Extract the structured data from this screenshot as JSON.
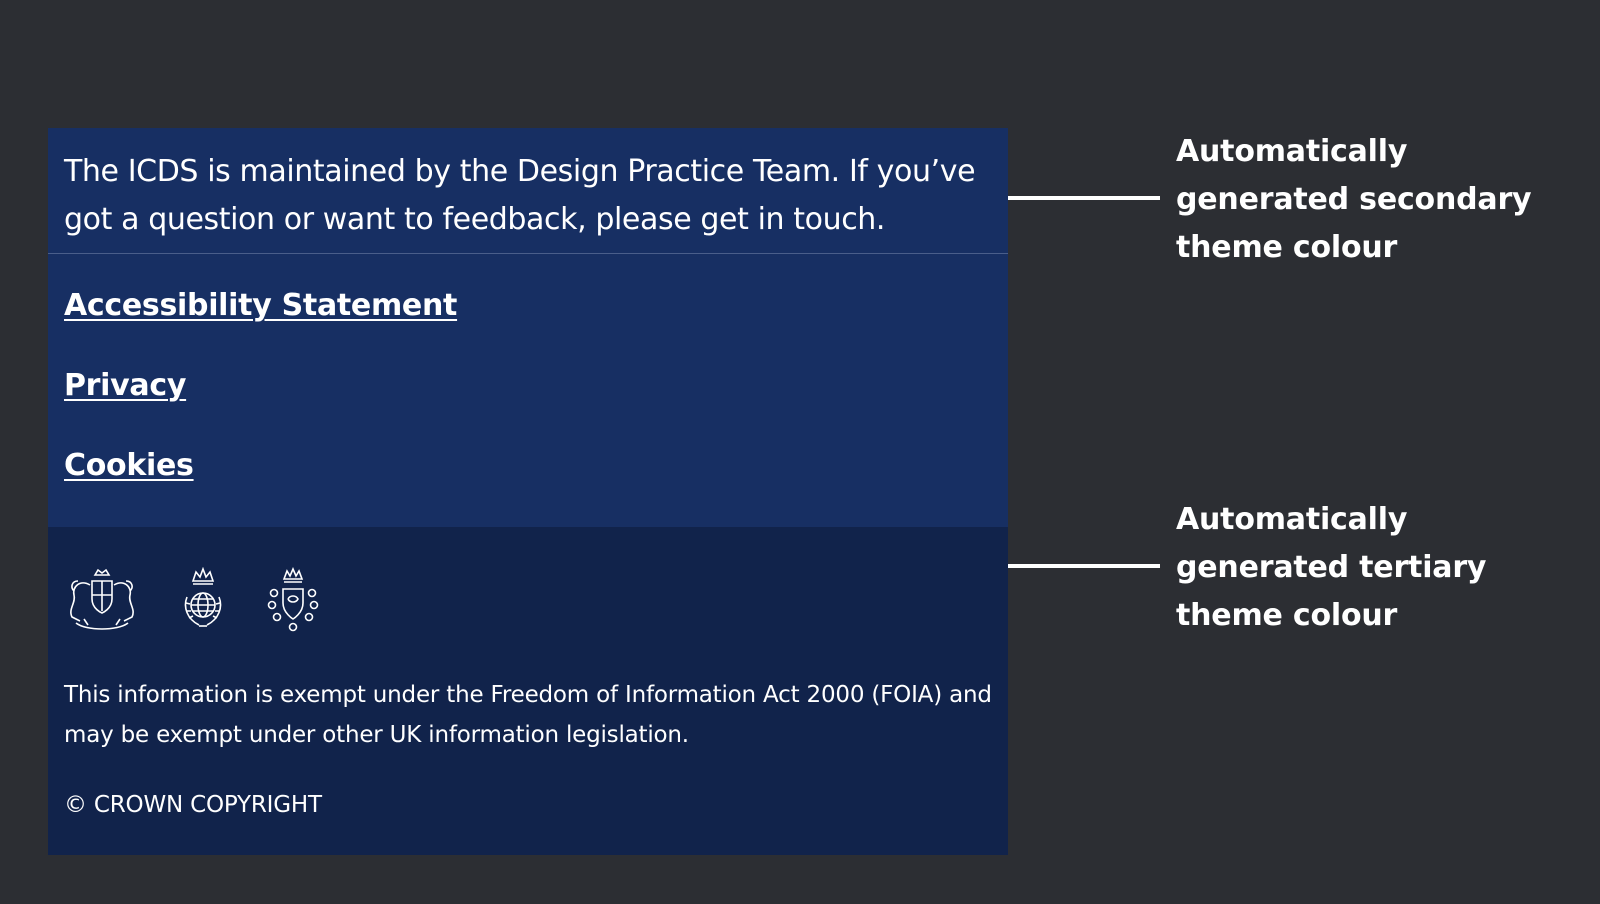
{
  "footer": {
    "intro_text": "The ICDS is maintained by the Design Practice Team. If you’ve got a question or want to feedback, please get in touch.",
    "links": [
      {
        "label": "Accessibility Statement"
      },
      {
        "label": "Privacy"
      },
      {
        "label": "Cookies"
      }
    ],
    "crests": [
      {
        "icon": "royal-coat-of-arms-icon"
      },
      {
        "icon": "crown-globe-emblem-icon"
      },
      {
        "icon": "crowned-shield-badge-icon"
      }
    ],
    "legal_text": "This information is exempt under the Freedom of Information Act 2000 (FOIA) and may be exempt under other UK information legislation.",
    "copyright_text": "© CROWN COPYRIGHT"
  },
  "annotations": {
    "secondary": "Automatically generated secondary theme colour",
    "tertiary": "Automatically generated tertiary theme colour"
  },
  "colors": {
    "page_background": "#2c2e33",
    "secondary_theme": "#172f63",
    "tertiary_theme": "#11234b",
    "text": "#ffffff"
  }
}
